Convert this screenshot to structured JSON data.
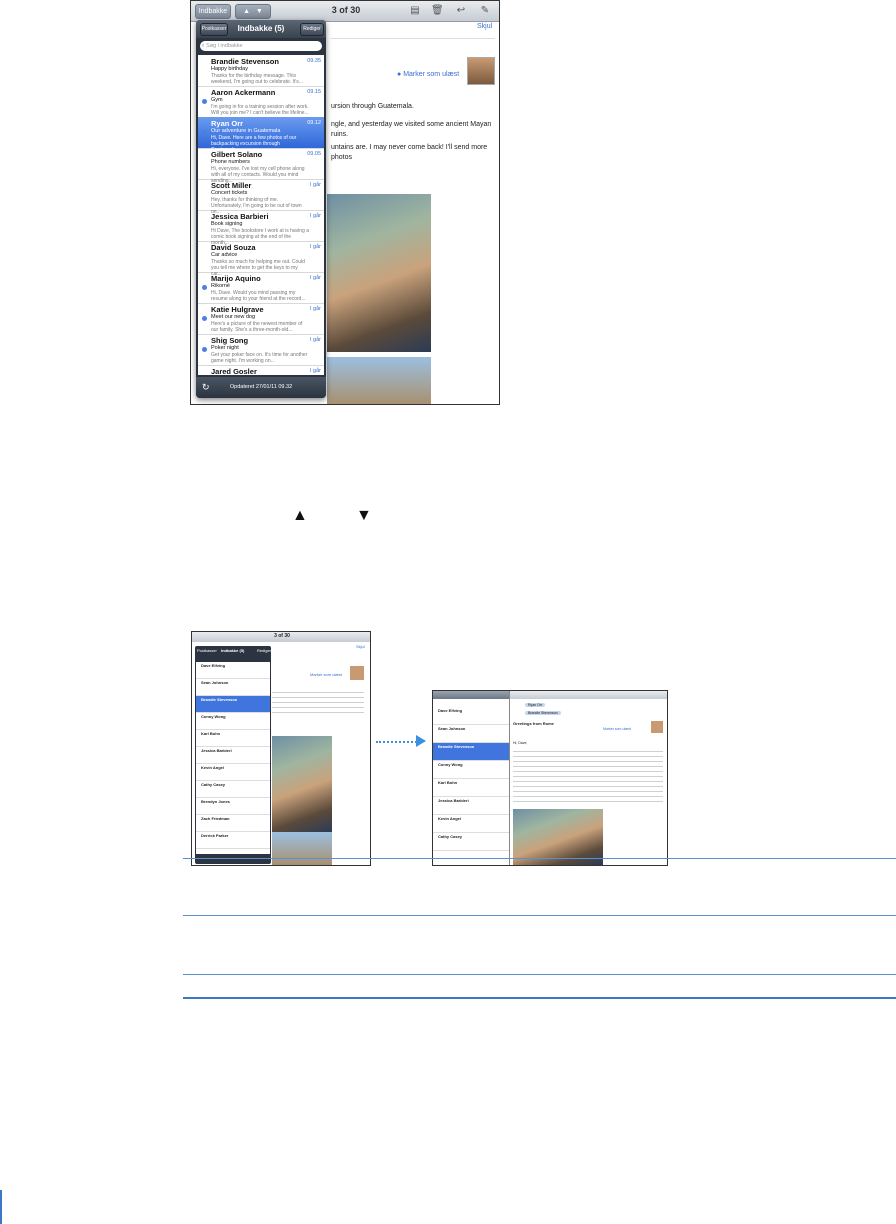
{
  "screenshot1": {
    "toolbar": {
      "inbox_btn": "Indbakke (5)",
      "counter": "3 of 30",
      "show_link": "Skjul"
    },
    "popover": {
      "mailboxes_btn": "Postkasser",
      "title": "Indbakke (5)",
      "edit_btn": "Rediger",
      "search_placeholder": "Søg i indbakke",
      "footer": "Opdateret 27/01/11 09.32",
      "messages": [
        {
          "name": "Brandie Stevenson",
          "time": "09.35",
          "subject": "Happy birthday",
          "preview": "Thanks for the birthday message. This weekend, I'm going out to celebrate. It's..."
        },
        {
          "name": "Aaron Ackermann",
          "time": "09.15",
          "subject": "Gym",
          "preview": "I'm going in for a training session after work. Will you join me? I can't believe the lifeline..."
        },
        {
          "name": "Ryan Orr",
          "time": "09.12",
          "subject": "Our adventure in Guatemala",
          "preview": "Hi, Dave. Here are a few photos of our backpacking excursion through Guatemala..."
        },
        {
          "name": "Gilbert Solano",
          "time": "09.05",
          "subject": "Phone numbers",
          "preview": "Hi, everyone. I've lost my cell phone along with all of my contacts. Would you mind sending..."
        },
        {
          "name": "Scott Miller",
          "time": "I går",
          "subject": "Concert tickets",
          "preview": "Hey, thanks for thinking of me. Unfortunately, I'm going to be out of town on..."
        },
        {
          "name": "Jessica Barbieri",
          "time": "I går",
          "subject": "Book signing",
          "preview": "Hi Dave, The bookstore I work at is having a comic book signing at the end of the month..."
        },
        {
          "name": "David Souza",
          "time": "I går",
          "subject": "Car advice",
          "preview": "Thanks so much for helping me out. Could you tell me where to get the keys to my car..."
        },
        {
          "name": "Marijo Aquino",
          "time": "I går",
          "subject": "Rikorné",
          "preview": "Hi, Dave. Would you mind passing my resume along to your friend at the record..."
        },
        {
          "name": "Katie Hulgrave",
          "time": "I går",
          "subject": "Meet our new dog",
          "preview": "Here's a picture of the newest member of our family. She's a three-month-old..."
        },
        {
          "name": "Shig Song",
          "time": "I går",
          "subject": "Poker night",
          "preview": "Get your poker face on. It's time for another game night. I'm working on..."
        },
        {
          "name": "Jared Gosler",
          "time": "I går",
          "subject": "",
          "preview": ""
        }
      ]
    },
    "message": {
      "mark_unread": "Marker som ulæst",
      "lines": [
        "ursion through Guatemala.",
        "ngle, and yesterday we visited some ancient Mayan ruins.",
        "untains are. I may never come back! I'll send more photos"
      ]
    }
  },
  "controls": {
    "up_arrow": "▲",
    "down_arrow": "▼"
  },
  "screenshot2": {
    "counter": "3 of 30",
    "popover_title": "Indbakke (5)",
    "mailboxes_btn": "Postkasser",
    "edit_btn": "Rediger",
    "mark_unread": "Marker som ulæst",
    "show_link": "Skjul",
    "names": [
      "Dave Elfving",
      "Sean Johnson",
      "Brandie Stevenson",
      "Conny Wong",
      "Karl Bohn",
      "Jessica Barbieri",
      "Kevin Angel",
      "Cathy Casey",
      "Brendyn Jones",
      "Zach Friedman",
      "Derrick Parker"
    ]
  },
  "screenshot3": {
    "names": [
      "Dave Elfving",
      "Sean Johnson",
      "Brandie Stevenson",
      "Conny Wong",
      "Karl Bohn",
      "Jessica Barbieri",
      "Kevin Angel",
      "Cathy Casey"
    ],
    "from_chip": "Ryan Orr",
    "to_chip": "Brandie Stevenson",
    "subject": "Greetings from Rome",
    "mark_unread": "Marker som ulæst",
    "greeting": "Hi, Dave,"
  }
}
